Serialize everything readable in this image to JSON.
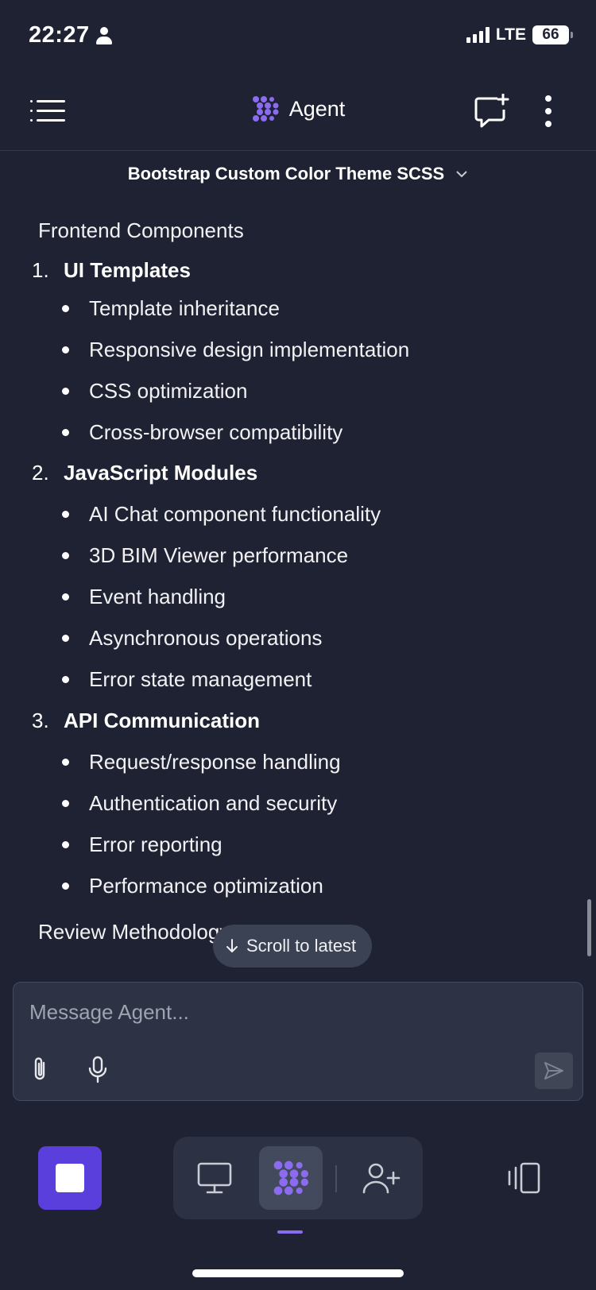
{
  "status": {
    "time": "22:27",
    "network": "LTE",
    "battery": "66"
  },
  "header": {
    "title": "Agent",
    "subtitle": "Bootstrap Custom Color Theme SCSS"
  },
  "content": {
    "section_heading": "Frontend Components",
    "items": [
      {
        "number": "1.",
        "title": "UI Templates",
        "bullets": [
          "Template inheritance",
          "Responsive design implementation",
          "CSS optimization",
          "Cross-browser compatibility"
        ]
      },
      {
        "number": "2.",
        "title": "JavaScript Modules",
        "bullets": [
          "AI Chat component functionality",
          "3D BIM Viewer performance",
          "Event handling",
          "Asynchronous operations",
          "Error state management"
        ]
      },
      {
        "number": "3.",
        "title": "API Communication",
        "bullets": [
          "Request/response handling",
          "Authentication and security",
          "Error reporting",
          "Performance optimization"
        ]
      }
    ],
    "next_heading": "Review Methodology"
  },
  "scroll_button": {
    "label": "Scroll to latest",
    "icon": "arrow-down-icon"
  },
  "composer": {
    "placeholder": "Message Agent..."
  },
  "colors": {
    "accent": "#5b3fdc",
    "agent_logo": "#8b6cf0",
    "background": "#1e2232",
    "surface": "#2d3244"
  }
}
